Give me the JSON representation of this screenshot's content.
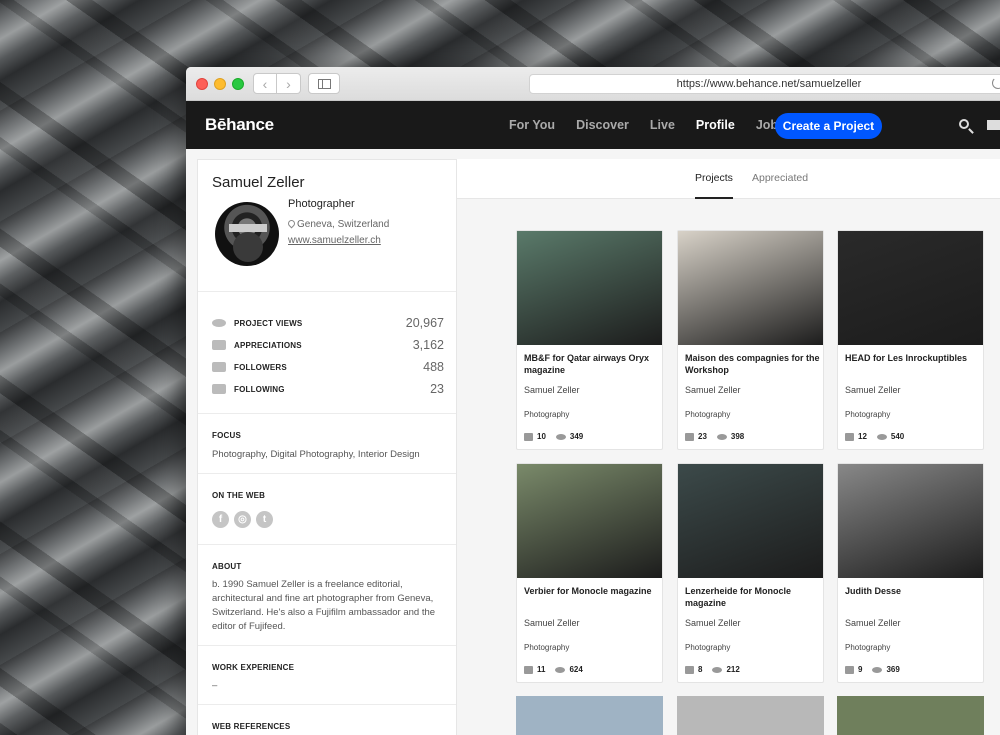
{
  "browser": {
    "url": "https://www.behance.net/samuelzeller",
    "back_glyph": "‹",
    "forward_glyph": "›"
  },
  "header": {
    "logo": "Bēhance",
    "nav": [
      "For You",
      "Discover",
      "Live",
      "Profile",
      "Jobs"
    ],
    "active_nav": "Profile",
    "create_label": "Create a Project",
    "accent": "#0057ff"
  },
  "profile": {
    "name": "Samuel Zeller",
    "occupation": "Photographer",
    "location": "Geneva, Switzerland",
    "website": "www.samuelzeller.ch",
    "stats": [
      {
        "label": "PROJECT VIEWS",
        "value": "20,967",
        "icon": "eye-icon"
      },
      {
        "label": "APPRECIATIONS",
        "value": "3,162",
        "icon": "thumbs-up-icon"
      },
      {
        "label": "FOLLOWERS",
        "value": "488",
        "icon": "user-plus-icon"
      },
      {
        "label": "FOLLOWING",
        "value": "23",
        "icon": "user-arrow-icon"
      }
    ],
    "focus_title": "FOCUS",
    "focus": "Photography, Digital Photography, Interior Design",
    "web_title": "ON THE WEB",
    "social": [
      "f",
      "◎",
      "t"
    ],
    "about_title": "ABOUT",
    "about": "b. 1990 Samuel Zeller is a freelance editorial, architectural and fine art photographer from Geneva, Switzerland. He's also a Fujifilm ambassador and the editor of Fujifeed.",
    "work_title": "WORK EXPERIENCE",
    "work": "–",
    "refs_title": "WEB REFERENCES"
  },
  "tabs": [
    "Projects",
    "Appreciated"
  ],
  "projects": [
    {
      "title": "MB&F for Qatar airways Oryx magazine",
      "owner": "Samuel Zeller",
      "field": "Photography",
      "likes": "10",
      "views": "349",
      "color": "#5a7a6a"
    },
    {
      "title": "Maison des compagnies for the Workshop",
      "owner": "Samuel Zeller",
      "field": "Photography",
      "likes": "23",
      "views": "398",
      "color": "#d8d2c8"
    },
    {
      "title": "HEAD for Les Inrockuptibles",
      "owner": "Samuel Zeller",
      "field": "Photography",
      "likes": "12",
      "views": "540",
      "color": "#2a2a2a"
    },
    {
      "title": "Verbier for Monocle magazine",
      "owner": "Samuel Zeller",
      "field": "Photography",
      "likes": "11",
      "views": "624",
      "color": "#7a8a6a"
    },
    {
      "title": "Lenzerheide for Monocle magazine",
      "owner": "Samuel Zeller",
      "field": "Photography",
      "likes": "8",
      "views": "212",
      "color": "#3c4a4a"
    },
    {
      "title": "Judith Desse",
      "owner": "Samuel Zeller",
      "field": "Photography",
      "likes": "9",
      "views": "369",
      "color": "#888888"
    }
  ]
}
